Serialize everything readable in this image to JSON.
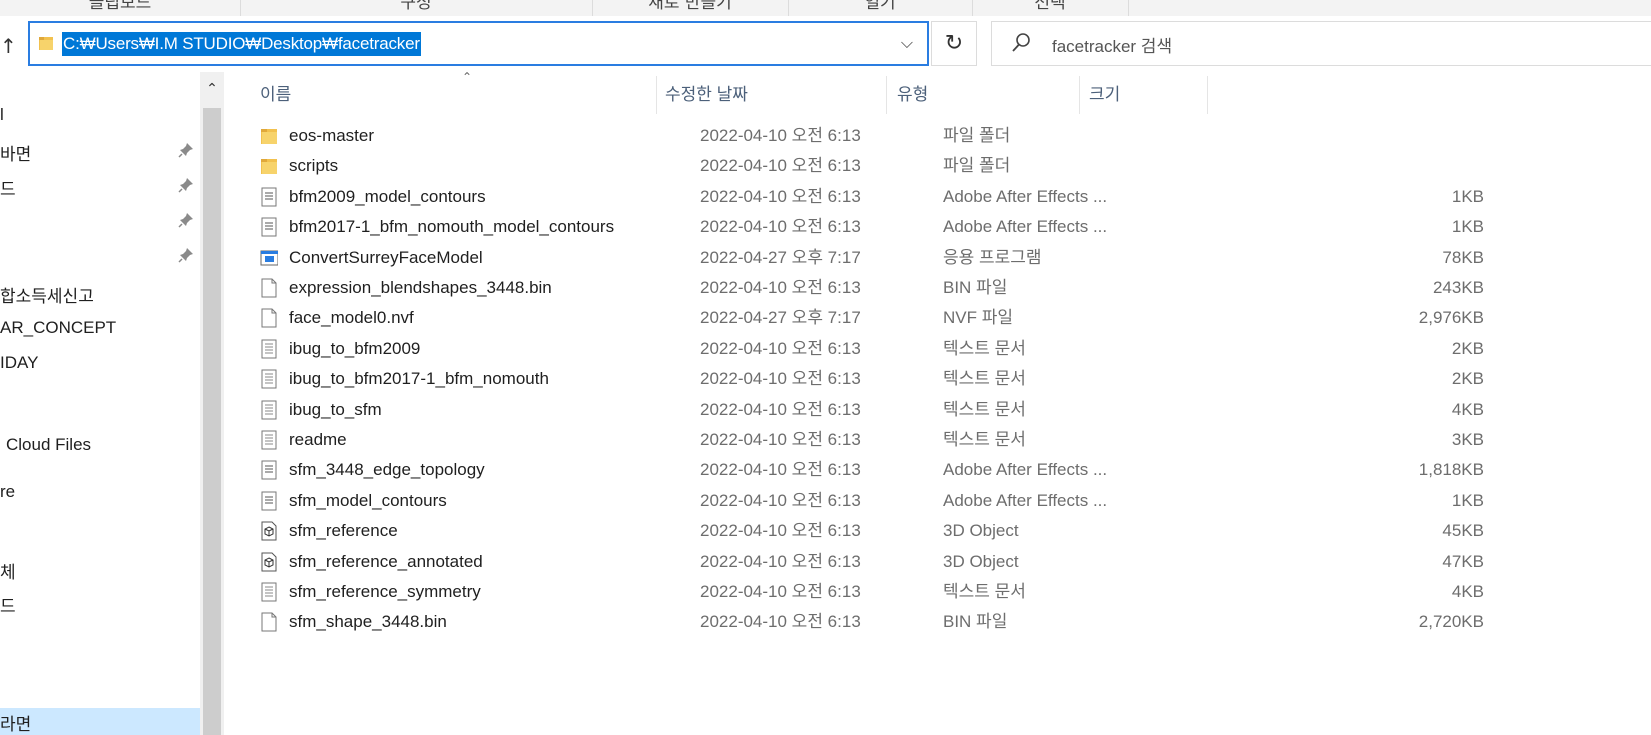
{
  "ribbon": {
    "groups": [
      "클립보드",
      "구성",
      "새로 만들기",
      "열기",
      "선택"
    ]
  },
  "address": {
    "up_label": "↑",
    "path": "C:₩Users₩I.M STUDIO₩Desktop₩facetracker",
    "dropdown_label": "⌵",
    "refresh_label": "↻"
  },
  "search": {
    "placeholder": "facetracker 검색"
  },
  "nav": {
    "items": [
      {
        "label": "l",
        "pinned": false
      },
      {
        "label": "바탕 화면",
        "display": "바면",
        "pinned": true
      },
      {
        "label": "다운로드",
        "display": "드",
        "pinned": true
      },
      {
        "label": "",
        "pinned": true
      },
      {
        "label": "",
        "pinned": true
      },
      {
        "label": "합소득세신고",
        "pinned": false
      },
      {
        "label": "AR_CONCEPT",
        "pinned": false
      },
      {
        "label": "IDAY",
        "pinned": false
      },
      {
        "label": "Cloud Files",
        "pinned": false
      },
      {
        "label": "re",
        "pinned": false
      },
      {
        "label": "체",
        "pinned": false
      },
      {
        "label": "드",
        "pinned": false
      },
      {
        "label": "화면",
        "display": "라면",
        "pinned": false
      }
    ],
    "scroll_up_label": "⌃"
  },
  "columns": {
    "name": "이름",
    "date": "수정한 날짜",
    "type": "유형",
    "size": "크기",
    "sort_indicator": "⌃"
  },
  "files": [
    {
      "name": "eos-master",
      "date": "2022-04-10 오전 6:13",
      "type": "파일 폴더",
      "size": "",
      "icon": "folder-icon"
    },
    {
      "name": "scripts",
      "date": "2022-04-10 오전 6:13",
      "type": "파일 폴더",
      "size": "",
      "icon": "folder-icon"
    },
    {
      "name": "bfm2009_model_contours",
      "date": "2022-04-10 오전 6:13",
      "type": "Adobe After Effects ...",
      "size": "1KB",
      "icon": "document-list-icon"
    },
    {
      "name": "bfm2017-1_bfm_nomouth_model_contours",
      "date": "2022-04-10 오전 6:13",
      "type": "Adobe After Effects ...",
      "size": "1KB",
      "icon": "document-list-icon"
    },
    {
      "name": "ConvertSurreyFaceModel",
      "date": "2022-04-27 오후 7:17",
      "type": "응용 프로그램",
      "size": "78KB",
      "icon": "application-icon"
    },
    {
      "name": "expression_blendshapes_3448.bin",
      "date": "2022-04-10 오전 6:13",
      "type": "BIN 파일",
      "size": "243KB",
      "icon": "blank-file-icon"
    },
    {
      "name": "face_model0.nvf",
      "date": "2022-04-27 오후 7:17",
      "type": "NVF 파일",
      "size": "2,976KB",
      "icon": "blank-file-icon"
    },
    {
      "name": "ibug_to_bfm2009",
      "date": "2022-04-10 오전 6:13",
      "type": "텍스트 문서",
      "size": "2KB",
      "icon": "text-file-icon"
    },
    {
      "name": "ibug_to_bfm2017-1_bfm_nomouth",
      "date": "2022-04-10 오전 6:13",
      "type": "텍스트 문서",
      "size": "2KB",
      "icon": "text-file-icon"
    },
    {
      "name": "ibug_to_sfm",
      "date": "2022-04-10 오전 6:13",
      "type": "텍스트 문서",
      "size": "4KB",
      "icon": "text-file-icon"
    },
    {
      "name": "readme",
      "date": "2022-04-10 오전 6:13",
      "type": "텍스트 문서",
      "size": "3KB",
      "icon": "text-file-icon"
    },
    {
      "name": "sfm_3448_edge_topology",
      "date": "2022-04-10 오전 6:13",
      "type": "Adobe After Effects ...",
      "size": "1,818KB",
      "icon": "document-list-icon"
    },
    {
      "name": "sfm_model_contours",
      "date": "2022-04-10 오전 6:13",
      "type": "Adobe After Effects ...",
      "size": "1KB",
      "icon": "document-list-icon"
    },
    {
      "name": "sfm_reference",
      "date": "2022-04-10 오전 6:13",
      "type": "3D Object",
      "size": "45KB",
      "icon": "3d-object-icon"
    },
    {
      "name": "sfm_reference_annotated",
      "date": "2022-04-10 오전 6:13",
      "type": "3D Object",
      "size": "47KB",
      "icon": "3d-object-icon"
    },
    {
      "name": "sfm_reference_symmetry",
      "date": "2022-04-10 오전 6:13",
      "type": "텍스트 문서",
      "size": "4KB",
      "icon": "text-file-icon"
    },
    {
      "name": "sfm_shape_3448.bin",
      "date": "2022-04-10 오전 6:13",
      "type": "BIN 파일",
      "size": "2,720KB",
      "icon": "blank-file-icon"
    }
  ],
  "colors": {
    "accent": "#0078d7",
    "address_border": "#2a7de1",
    "folder": "#f2c14e",
    "header_text": "#4c607a",
    "selected_nav": "#cce8ff"
  }
}
